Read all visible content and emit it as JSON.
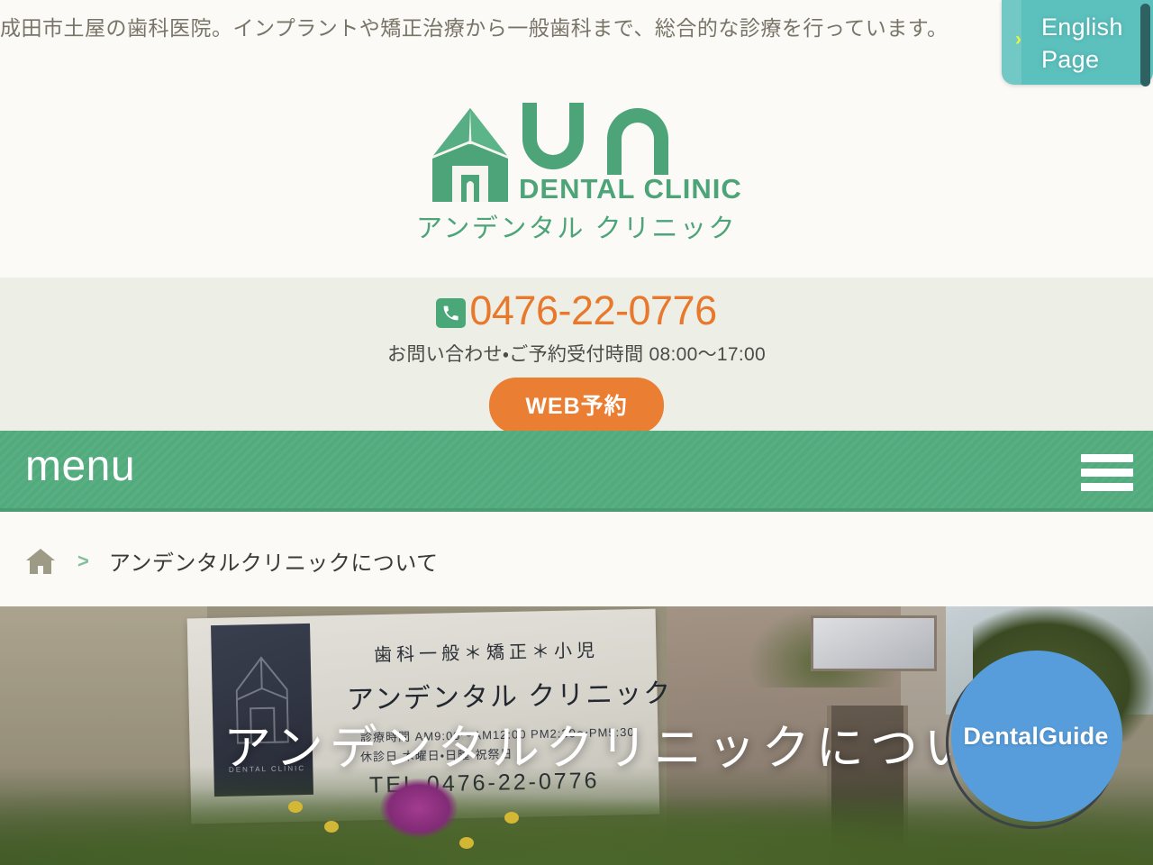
{
  "meta": {
    "site_description": "成田市土屋の歯科医院。インプラントや矯正治療から一般歯科まで、総合的な診療を行っています。"
  },
  "english_tab": {
    "line1": "English",
    "line2": "Page",
    "chevron": "›",
    "bg_color": "#5cc0bd",
    "chevron_color": "#eaf53c"
  },
  "logo": {
    "brand": "UN",
    "subtitle": "DENTAL CLINIC",
    "japanese_name": "アンデンタル クリニック",
    "color": "#4ca478",
    "mark_icon": "house-clinic-icon"
  },
  "contact": {
    "phone_icon": "phone-handset-icon",
    "phone": "0476-22-0776",
    "phone_color": "#e8792c",
    "hours": "お問い合わせ・ご予約受付時間 08:00〜17:00",
    "reserve_label": "WEB予約",
    "reserve_color": "#ea7e33",
    "band_color": "#edeee6"
  },
  "menu_bar": {
    "label": "menu",
    "hamburger_icon": "hamburger-menu-icon",
    "bg_color": "#52ab7d"
  },
  "breadcrumb": {
    "home_icon": "home-icon",
    "separator": ">",
    "current": "アンデンタルクリニックについて"
  },
  "hero": {
    "overlay_title": "アンデンタルクリニックについ",
    "sign": {
      "line1": "歯科一般＊矯正＊小児",
      "line2": "アンデンタル クリニック",
      "line3": "診療時間 AM9:00〜AM12:00 PM2:30〜PM5:30",
      "line4": "休診日 木曜日・日曜・祝祭日",
      "line5": "TEL 0476-22-0776",
      "plate_label": "DENTAL CLINIC",
      "plate_icon": "house-clinic-icon"
    }
  },
  "dental_guide_badge": {
    "label": "DentalGuide",
    "circle_color": "#579ddb"
  },
  "scrollbar": {
    "name": "vertical-scrollbar",
    "thumb_color": "#2f6163"
  }
}
